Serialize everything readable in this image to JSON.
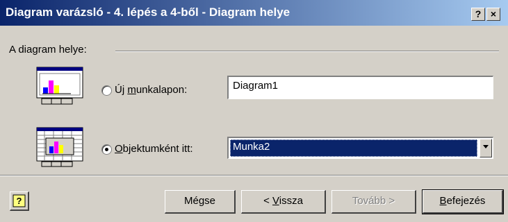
{
  "window": {
    "title": "Diagram varázsló - 4. lépés a 4-ből - Diagram helye",
    "help_button": "?",
    "close_button": "×"
  },
  "group": {
    "label": "A diagram helye:"
  },
  "options": {
    "new_sheet": {
      "label_prefix": "Új ",
      "label_underlined": "m",
      "label_suffix": "unkalapon:",
      "value": "Diagram1",
      "selected": false
    },
    "as_object": {
      "label_prefix": "",
      "label_underlined": "O",
      "label_suffix": "bjektumként itt:",
      "value": "Munka2",
      "selected": true
    }
  },
  "buttons": {
    "cancel": "Mégse",
    "back_prefix": "< ",
    "back_underlined": "V",
    "back_suffix": "issza",
    "next": "Tovább >",
    "finish_underlined": "B",
    "finish_suffix": "efejezés"
  },
  "colors": {
    "title_gradient_start": "#0a246a",
    "title_gradient_end": "#a6caf0",
    "face": "#d4d0c8"
  }
}
